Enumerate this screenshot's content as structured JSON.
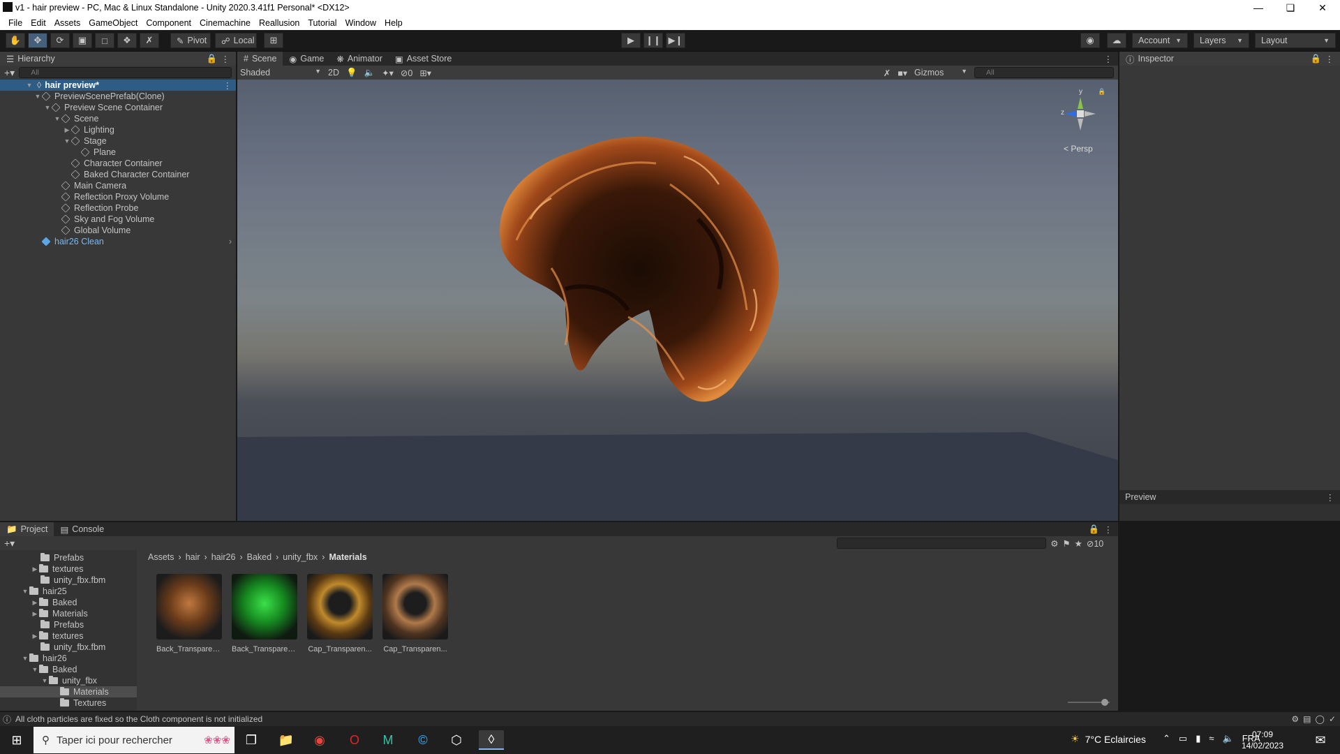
{
  "window": {
    "title": "v1 - hair preview - PC, Mac & Linux Standalone - Unity 2020.3.41f1 Personal* <DX12>"
  },
  "menu": [
    "File",
    "Edit",
    "Assets",
    "GameObject",
    "Component",
    "Cinemachine",
    "Reallusion",
    "Tutorial",
    "Window",
    "Help"
  ],
  "toolbar": {
    "pivot": "Pivot",
    "local": "Local",
    "account": "Account",
    "layers": "Layers",
    "layout": "Layout"
  },
  "hierarchy": {
    "tab": "Hierarchy",
    "search_placeholder": "All",
    "scene_name": "hair preview*",
    "items": [
      {
        "label": "PreviewScenePrefab(Clone)"
      },
      {
        "label": "Preview Scene Container"
      },
      {
        "label": "Scene"
      },
      {
        "label": "Lighting"
      },
      {
        "label": "Stage"
      },
      {
        "label": "Plane"
      },
      {
        "label": "Character Container"
      },
      {
        "label": "Baked Character Container"
      },
      {
        "label": "Main Camera"
      },
      {
        "label": "Reflection Proxy Volume"
      },
      {
        "label": "Reflection Probe"
      },
      {
        "label": "Sky and Fog Volume"
      },
      {
        "label": "Global Volume"
      },
      {
        "label": "hair26 Clean"
      }
    ]
  },
  "scene": {
    "tabs": [
      "Scene",
      "Game",
      "Animator",
      "Asset Store"
    ],
    "shading": "Shaded",
    "mode_2d": "2D",
    "hidden_count": "0",
    "gizmos": "Gizmos",
    "search_placeholder": "All",
    "persp": "< Persp",
    "axis_y": "y",
    "axis_z": "z"
  },
  "inspector": {
    "tab": "Inspector",
    "preview": "Preview"
  },
  "project": {
    "tabs": [
      "Project",
      "Console"
    ],
    "hidden_count": "10",
    "breadcrumb": [
      "Assets",
      "hair",
      "hair26",
      "Baked",
      "unity_fbx",
      "Materials"
    ],
    "tree": [
      {
        "label": "Prefabs"
      },
      {
        "label": "textures"
      },
      {
        "label": "unity_fbx.fbm"
      },
      {
        "label": "hair25"
      },
      {
        "label": "Baked"
      },
      {
        "label": "Materials"
      },
      {
        "label": "Prefabs"
      },
      {
        "label": "textures"
      },
      {
        "label": "unity_fbx.fbm"
      },
      {
        "label": "hair26"
      },
      {
        "label": "Baked"
      },
      {
        "label": "unity_fbx"
      },
      {
        "label": "Materials"
      },
      {
        "label": "Textures"
      }
    ],
    "assets": [
      {
        "label": "Back_Transparen...",
        "color": "#8a5a32"
      },
      {
        "label": "Back_Transparen...",
        "color": "#1fa828"
      },
      {
        "label": "Cap_Transparen...",
        "color": "#b07a1c"
      },
      {
        "label": "Cap_Transparen...",
        "color": "#9a6a3e"
      }
    ]
  },
  "status": {
    "message": "All cloth particles are fixed so the Cloth component is not initialized"
  },
  "taskbar": {
    "search_placeholder": "Taper ici pour rechercher",
    "weather": "7°C Eclaircies",
    "lang": "FRA",
    "time": "07:09",
    "date": "14/02/2023"
  }
}
